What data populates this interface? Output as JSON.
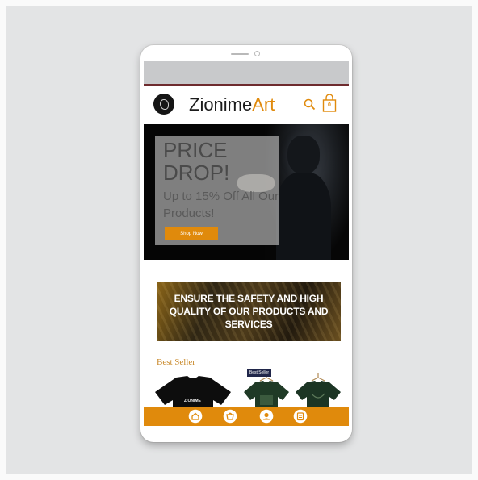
{
  "brand": {
    "name_main": "Zionime",
    "name_accent": "Art",
    "accent_color": "#e08a0c"
  },
  "header": {
    "search_icon": "search-icon",
    "cart_icon": "shopping-bag-icon",
    "cart_count": "0"
  },
  "hero": {
    "title": "PRICE DROP!",
    "subtitle": "Up to 15% Off All Our Products!",
    "button_label": "Shop Now"
  },
  "promo": {
    "text": "ENSURE THE SAFETY AND HIGH QUALITY OF OUR PRODUCTS AND SERVICES"
  },
  "best_seller": {
    "title": "Best Seller",
    "badge": "Best Seller",
    "products": [
      {
        "label": "ZIONIME"
      }
    ]
  },
  "bottom_nav": {
    "items": [
      "home-icon",
      "shopping-bag-icon",
      "account-icon",
      "orders-icon"
    ]
  }
}
